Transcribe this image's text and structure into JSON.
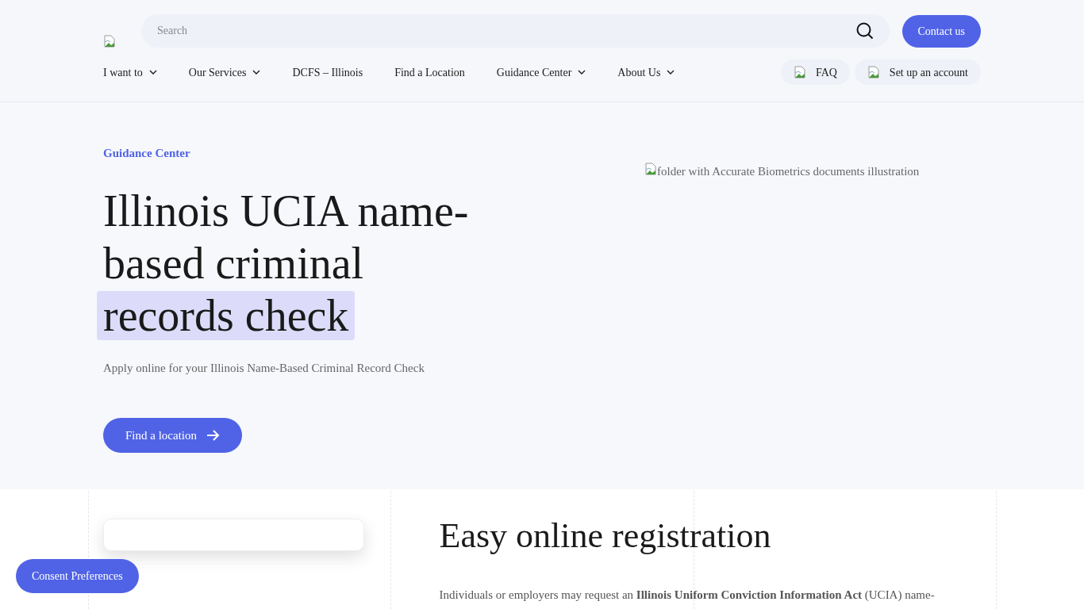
{
  "header": {
    "search": {
      "placeholder": "Search"
    },
    "contact_button": "Contact us",
    "nav": [
      {
        "label": "I want to",
        "has_menu": true
      },
      {
        "label": "Our Services",
        "has_menu": true
      },
      {
        "label": "DCFS – Illinois",
        "has_menu": false
      },
      {
        "label": "Find a Location",
        "has_menu": false
      },
      {
        "label": "Guidance Center",
        "has_menu": true
      },
      {
        "label": "About Us",
        "has_menu": true
      }
    ],
    "quick_links": [
      "FAQ",
      "Set up an account"
    ]
  },
  "hero": {
    "eyebrow": "Guidance Center",
    "title_lines": [
      "Illinois UCIA name-",
      "based criminal"
    ],
    "title_highlight": "records check",
    "subtitle": "Apply online for your Illinois Name-Based Criminal Record Check",
    "button": "Find a location",
    "image_alt": "folder with Accurate Biometrics documents illustration"
  },
  "registration": {
    "heading": "Easy online registration",
    "text": "Individuals or employers may request an **Illinois Uniform Conviction Information Act** (UCIA) name-"
  },
  "consent_button": "Consent Preferences"
}
